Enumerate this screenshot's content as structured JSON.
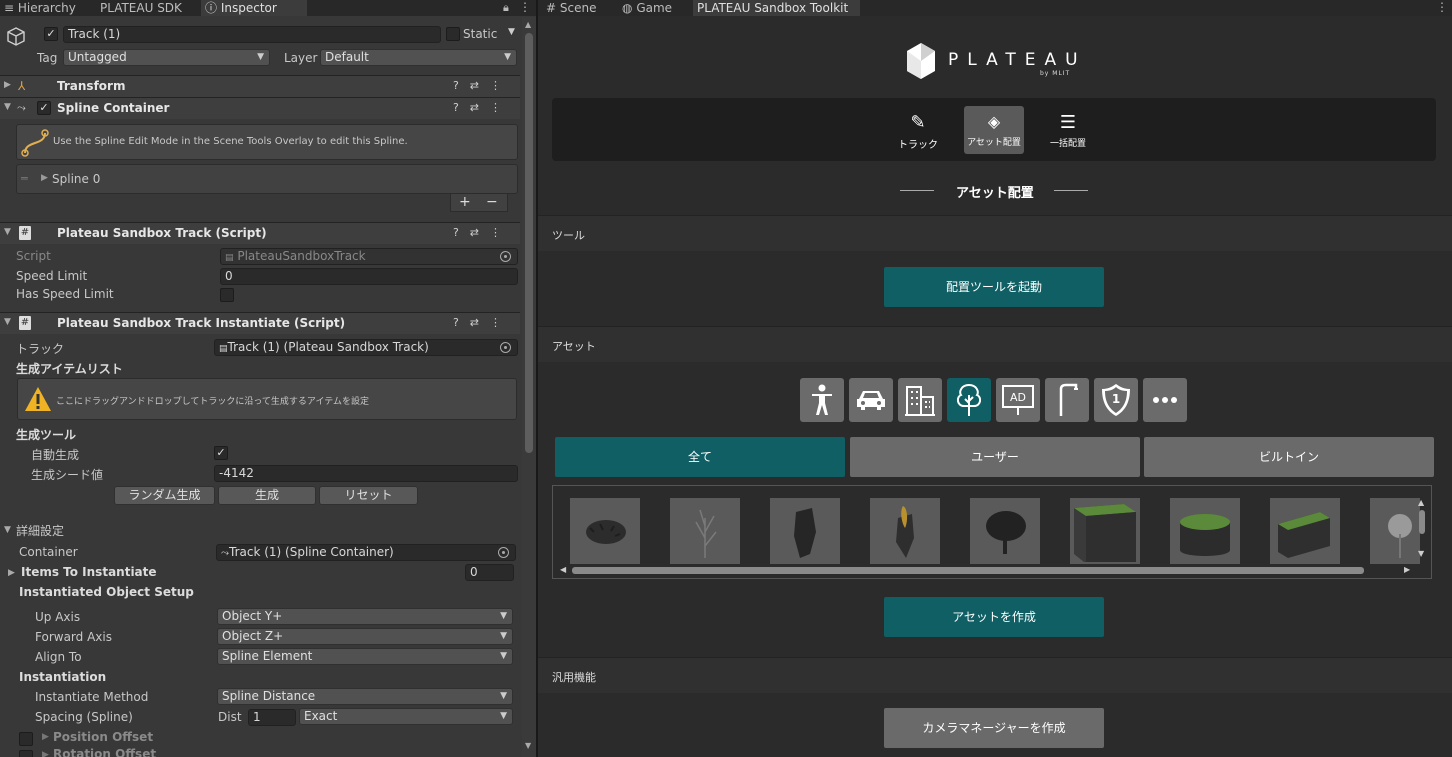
{
  "left_tabs": [
    "Hierarchy",
    "PLATEAU SDK",
    "Inspector"
  ],
  "right_tabs": [
    "Scene",
    "Game",
    "PLATEAU Sandbox Toolkit"
  ],
  "object": {
    "name": "Track (1)",
    "static_label": "Static",
    "tag_label": "Tag",
    "tag_value": "Untagged",
    "layer_label": "Layer",
    "layer_value": "Default"
  },
  "transform": {
    "title": "Transform"
  },
  "spline_container": {
    "title": "Spline Container",
    "info": "Use the Spline Edit Mode in the Scene Tools Overlay to edit this Spline.",
    "spline_item": "Spline 0",
    "add": "+",
    "remove": "−"
  },
  "track_script": {
    "title": "Plateau Sandbox Track (Script)",
    "script_label": "Script",
    "script_value": "PlateauSandboxTrack",
    "speed_label": "Speed Limit",
    "speed_value": "0",
    "has_speed_label": "Has Speed Limit"
  },
  "instantiate_script": {
    "title": "Plateau Sandbox Track Instantiate (Script)",
    "track_label": "トラック",
    "track_value": "Track (1) (Plateau Sandbox Track)",
    "list_header": "生成アイテムリスト",
    "warning": "ここにドラッグアンドドロップしてトラックに沿って生成するアイテムを設定",
    "tool_header": "生成ツール",
    "auto_label": "自動生成",
    "seed_label": "生成シード値",
    "seed_value": "-4142",
    "random_btn": "ランダム生成",
    "generate_btn": "生成",
    "reset_btn": "リセット"
  },
  "advanced": {
    "header": "詳細設定",
    "container_label": "Container",
    "container_value": "Track (1) (Spline Container)",
    "items_label": "Items To Instantiate",
    "items_value": "0",
    "setup_header": "Instantiated Object Setup",
    "up_label": "Up Axis",
    "up_value": "Object Y+",
    "forward_label": "Forward Axis",
    "forward_value": "Object Z+",
    "align_label": "Align To",
    "align_value": "Spline Element",
    "inst_header": "Instantiation",
    "method_label": "Instantiate Method",
    "method_value": "Spline Distance",
    "spacing_label": "Spacing (Spline)",
    "dist_label": "Dist",
    "dist_value": "1",
    "exact_value": "Exact",
    "position_offset": "Position Offset",
    "rotation_offset": "Rotation Offset"
  },
  "toolkit": {
    "logo_text": "PLATEAU",
    "logo_sub": "by MLIT",
    "nav": [
      "トラック",
      "アセット配置",
      "一括配置"
    ],
    "page_title": "アセット配置",
    "tool_section": "ツール",
    "launch_btn": "配置ツールを起動",
    "asset_section": "アセット",
    "categories": [
      "person-icon",
      "car-icon",
      "building-icon",
      "tree-icon",
      "ad-sign-icon",
      "street-light-icon",
      "route-sign-icon",
      "more-icon"
    ],
    "filters": [
      "全て",
      "ユーザー",
      "ビルトイン"
    ],
    "create_asset_btn": "アセットを作成",
    "general_section": "汎用機能",
    "camera_btn": "カメラマネージャーを作成",
    "accent": "#0f5f64"
  }
}
